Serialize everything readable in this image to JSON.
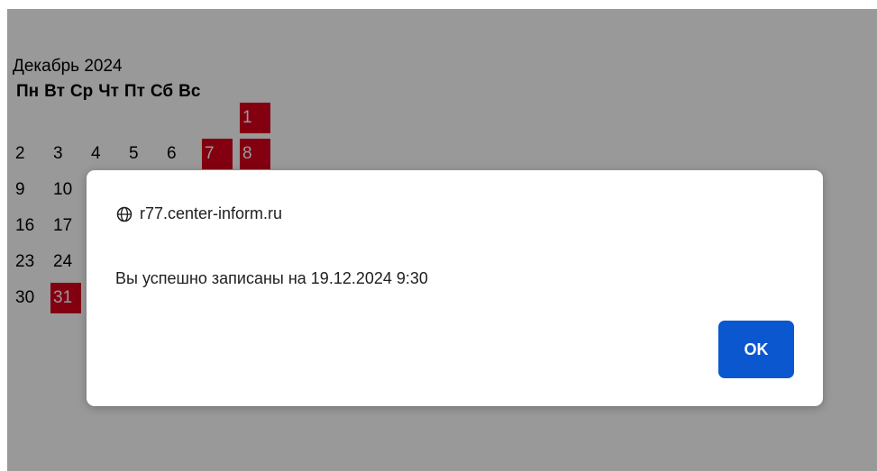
{
  "calendar": {
    "title": "Декабрь 2024",
    "weekdays": [
      "Пн",
      "Вт",
      "Ср",
      "Чт",
      "Пт",
      "Сб",
      "Вс"
    ],
    "visible_days": [
      {
        "label": "1",
        "busy": true
      },
      {
        "label": "2",
        "busy": false
      },
      {
        "label": "3",
        "busy": false
      },
      {
        "label": "4",
        "busy": false
      },
      {
        "label": "5",
        "busy": false
      },
      {
        "label": "6",
        "busy": false
      },
      {
        "label": "7",
        "busy": true
      },
      {
        "label": "8",
        "busy": true
      },
      {
        "label": "9",
        "busy": false
      },
      {
        "label": "10",
        "busy": false
      },
      {
        "label": "16",
        "busy": false
      },
      {
        "label": "17",
        "busy": false
      },
      {
        "label": "23",
        "busy": false
      },
      {
        "label": "24",
        "busy": false
      },
      {
        "label": "30",
        "busy": false
      },
      {
        "label": "31",
        "busy": true
      }
    ]
  },
  "dialog": {
    "origin": "r77.center-inform.ru",
    "message": "Вы успешно записаны на 19.12.2024 9:30",
    "ok_label": "OK"
  },
  "colors": {
    "busy_day": "#d9001b",
    "ok_button": "#0b57d0",
    "overlay": "rgba(0,0,0,0.40)"
  },
  "icons": {
    "origin": "globe-icon"
  }
}
